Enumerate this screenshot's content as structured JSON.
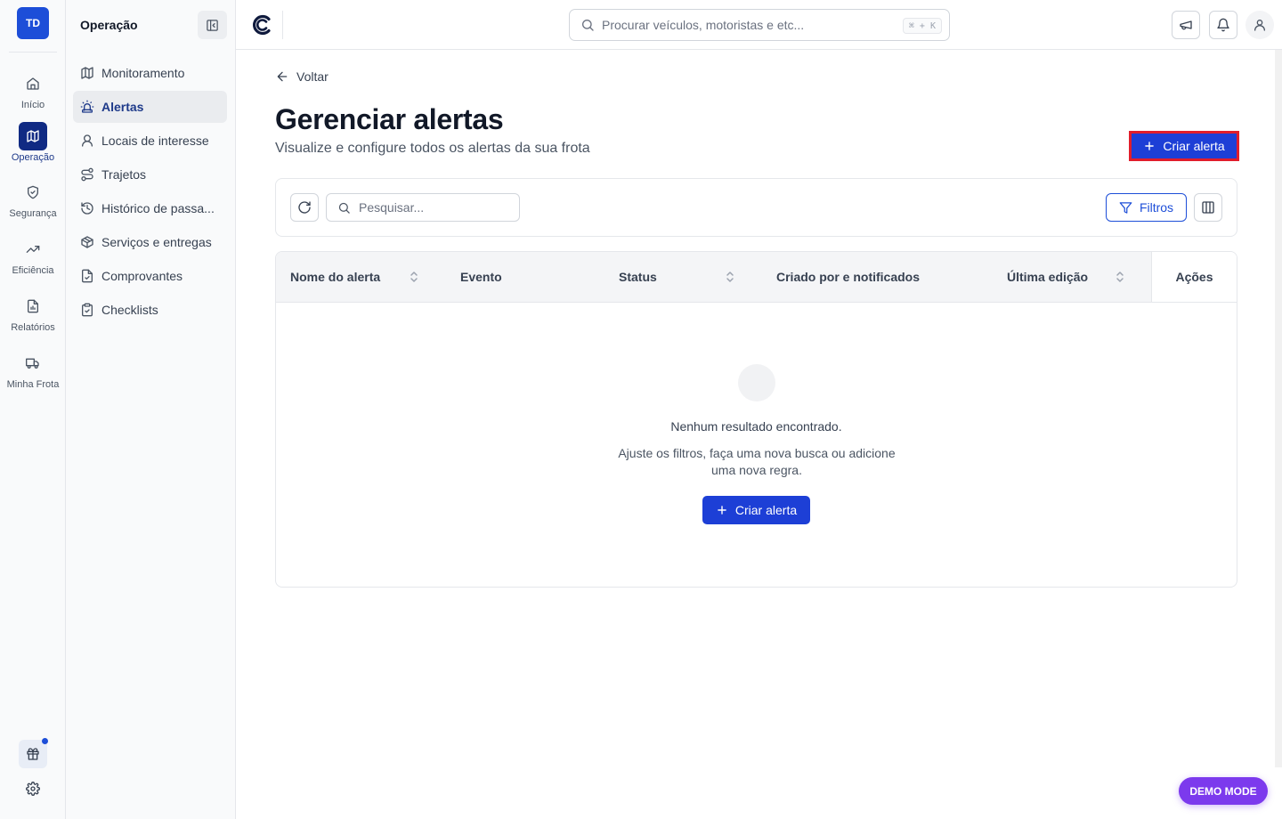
{
  "rail": {
    "org_initials": "TD",
    "items": [
      {
        "label": "Início",
        "icon": "home-icon"
      },
      {
        "label": "Operação",
        "icon": "map-icon",
        "active": true
      },
      {
        "label": "Segurança",
        "icon": "shield-icon"
      },
      {
        "label": "Eficiência",
        "icon": "trending-up-icon"
      },
      {
        "label": "Relatórios",
        "icon": "report-icon"
      },
      {
        "label": "Minha Frota",
        "icon": "truck-icon"
      }
    ],
    "gift_icon": "gift-icon",
    "settings_icon": "gear-icon"
  },
  "sidebar": {
    "title": "Operação",
    "items": [
      {
        "label": "Monitoramento",
        "icon": "map-icon"
      },
      {
        "label": "Alertas",
        "icon": "siren-icon",
        "active": true
      },
      {
        "label": "Locais de interesse",
        "icon": "user-pin-icon"
      },
      {
        "label": "Trajetos",
        "icon": "route-icon"
      },
      {
        "label": "Histórico de passa...",
        "icon": "history-icon"
      },
      {
        "label": "Serviços e entregas",
        "icon": "package-icon"
      },
      {
        "label": "Comprovantes",
        "icon": "document-icon"
      },
      {
        "label": "Checklists",
        "icon": "clipboard-check-icon"
      }
    ]
  },
  "topbar": {
    "search_placeholder": "Procurar veículos, motoristas e etc...",
    "shortcut": "⌘ + K"
  },
  "main": {
    "back_label": "Voltar",
    "title": "Gerenciar alertas",
    "subtitle": "Visualize e configure todos os alertas da sua frota",
    "create_button": "Criar alerta",
    "search_placeholder": "Pesquisar...",
    "filters_button": "Filtros",
    "table": {
      "columns": [
        "Nome do alerta",
        "Evento",
        "Status",
        "Criado por e notificados",
        "Última edição",
        "Ações"
      ],
      "rows": []
    },
    "empty": {
      "title": "Nenhum resultado encontrado.",
      "description": "Ajuste os filtros, faça uma nova busca ou adicione uma nova regra.",
      "button": "Criar alerta"
    }
  },
  "demo_badge": "DEMO MODE",
  "colors": {
    "primary": "#1d3fd6",
    "rail_active": "#102a83",
    "highlight_border": "#e11d2b",
    "demo_badge": "#7c3aed"
  }
}
